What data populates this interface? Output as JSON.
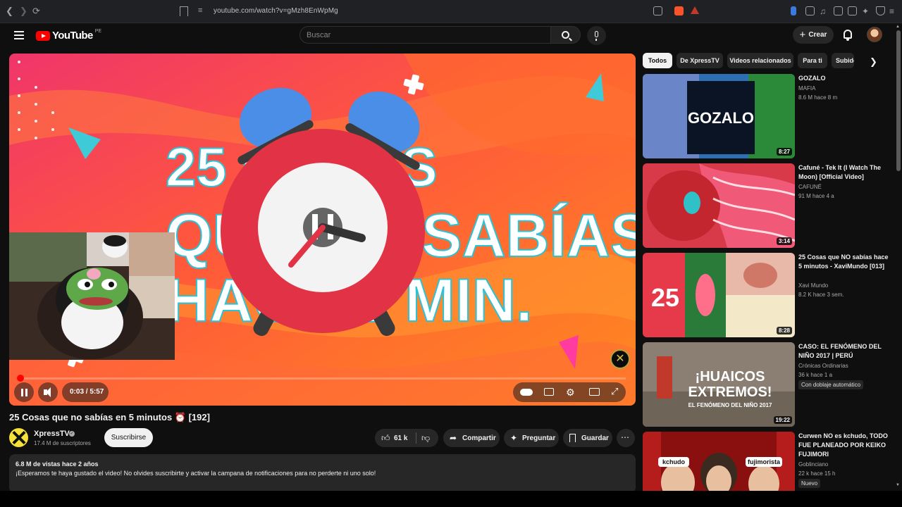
{
  "browser": {
    "url": "youtube.com/watch?v=gMzh8EnWpMg"
  },
  "header": {
    "logo_text": "YouTube",
    "country_code": "PE",
    "search_placeholder": "Buscar",
    "create_label": "Crear"
  },
  "player": {
    "time": "0:03 / 5:57",
    "progress": 0.0084,
    "title_overlay_lines": [
      "25 COSAS",
      "QUE NO SABÍAS",
      "HACE 5 MIN."
    ]
  },
  "video": {
    "title": "25 Cosas que no sabías en 5 minutos ⏰ [192]",
    "channel_name": "XpressTV",
    "subscribers": "17.4 M de suscriptores",
    "subscribe_label": "Suscribirse",
    "likes": "61 k",
    "share_label": "Compartir",
    "ask_label": "Preguntar",
    "save_label": "Guardar",
    "stats": "6.8 M de vistas  hace 2 años",
    "description": "¡Esperamos te haya gustado el video! No olvides suscribirte y activar la campana de notificaciones para no perderte ni uno solo!"
  },
  "chips": [
    "Todos",
    "De XpressTV",
    "Videos relacionados",
    "Para ti",
    "Subidos recientemente"
  ],
  "recommendations": [
    {
      "title": "GOZALO",
      "channel": "MAFIA",
      "meta": "8.6 M  hace 8 m",
      "duration": "8:27",
      "thumb_text": "GOZALO"
    },
    {
      "title": "Cafuné - Tek It (I Watch The Moon) [Official Video]",
      "channel": "CAFUNÉ",
      "meta": "91 M  hace 4 a",
      "duration": "3:14"
    },
    {
      "title": "25 Cosas que NO sabías hace 5 minutos - XaviMundo [013]",
      "channel": "Xavi Mundo",
      "meta": "8.2 K  hace 3 sem.",
      "duration": "8:28",
      "thumb_text": "25"
    },
    {
      "title": "CASO: EL FENÓMENO DEL NIÑO 2017 | PERÚ",
      "channel": "Crónicas Ordinarias",
      "meta": "36 k  hace 1 a",
      "badge": "Con doblaje automático",
      "duration": "19:22",
      "thumb_text_1": "¡HUAICOS",
      "thumb_text_2": "EXTREMOS!",
      "thumb_text_3": "EL FENÓMENO DEL NIÑO 2017"
    },
    {
      "title": "Curwen NO es kchudo, TODO FUE PLANEADO POR KEIKO FUJIMORI",
      "channel": "Goblinciano",
      "meta": "22 k  hace 15 h",
      "badge": "Nuevo",
      "thumb_tag_1": "kchudo",
      "thumb_tag_2": "fujimorista"
    }
  ],
  "colors": {
    "accent": "#ff0000",
    "background": "#0f0f0f",
    "surface": "#272727",
    "player_primary": "#ff5a1f",
    "clock_red": "#e23245",
    "bell_blue": "#4a8ee8"
  }
}
